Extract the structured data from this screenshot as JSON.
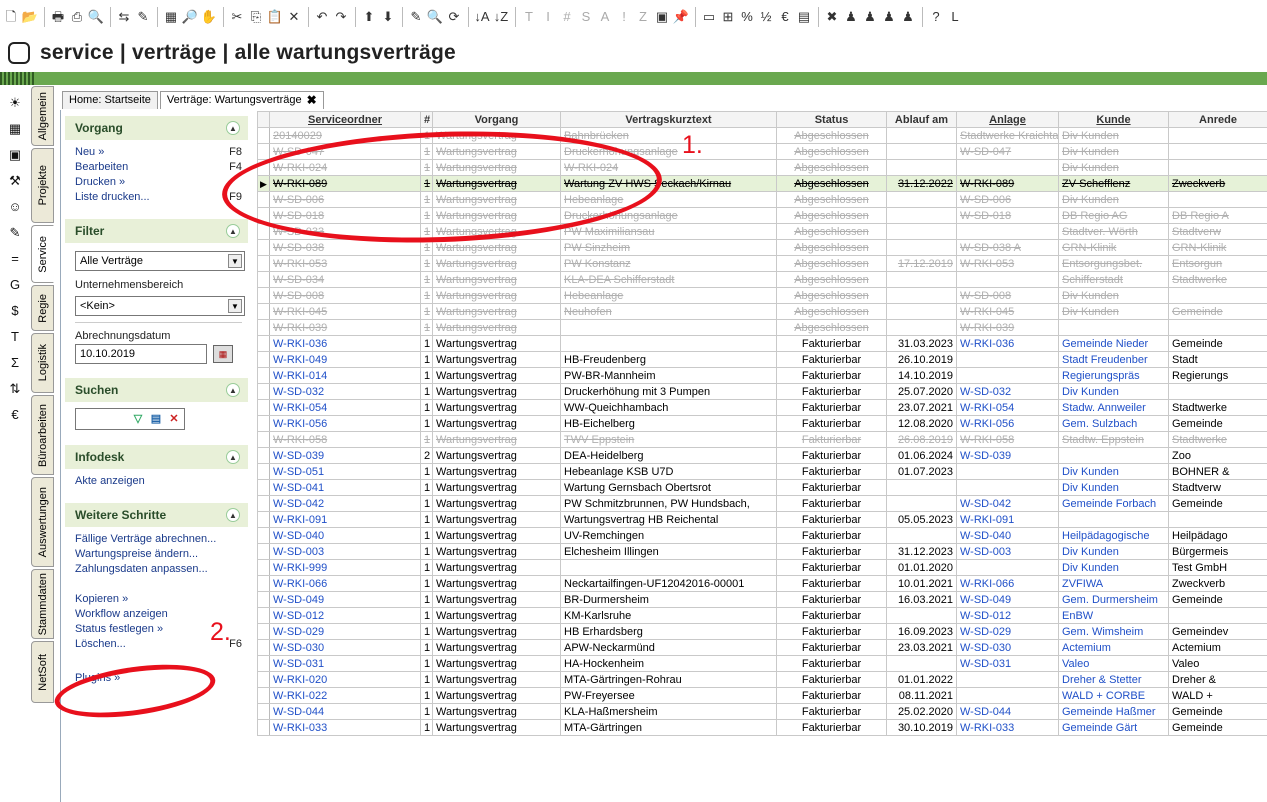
{
  "window": {
    "title": "service | verträge | alle wartungsverträge"
  },
  "toolbar": {
    "icons": [
      "new-document",
      "open-folder",
      "sep",
      "print",
      "print-setup",
      "print-preview",
      "sep",
      "transfer",
      "filter-clear",
      "sep",
      "grid",
      "search-doc",
      "hand",
      "sep",
      "cut",
      "copy",
      "paste",
      "delete",
      "sep",
      "undo",
      "redo",
      "sep",
      "arrow-up",
      "arrow-down",
      "sep",
      "edit",
      "search",
      "refresh",
      "sep",
      "sort-asc",
      "sort-desc",
      "sep",
      "T",
      "I",
      "#",
      "S",
      "A",
      "!",
      "Z",
      "image",
      "pin",
      "sep",
      "field",
      "plus-doc",
      "percent",
      "decimal",
      "currency",
      "grid2",
      "sep",
      "excel",
      "figure1",
      "figure2",
      "figure3",
      "figure4",
      "sep",
      "help",
      "L"
    ]
  },
  "left_icons": [
    "sun-icon",
    "grid-icon",
    "box-icon",
    "hammer-icon",
    "smile-icon",
    "pen-icon",
    "equals-icon",
    "g-icon",
    "dollar-icon",
    "t-icon",
    "sigma-icon",
    "arrows-icon",
    "e-icon"
  ],
  "vtabs": [
    "Allgemein",
    "Projekte",
    "Service",
    "Regie",
    "Logistik",
    "Büroarbeiten",
    "Auswertungen",
    "Stammdaten",
    "NetSoft"
  ],
  "tabs": [
    {
      "label": "Home: Startseite",
      "active": false
    },
    {
      "label": "Verträge: Wartungsverträge",
      "active": true,
      "close": "✖"
    }
  ],
  "sidebar": {
    "vorgang": {
      "title": "Vorgang",
      "items": [
        {
          "label": "Neu »",
          "key": "F8"
        },
        {
          "label": "Bearbeiten",
          "key": "F4"
        },
        {
          "label": "Drucken »",
          "key": ""
        },
        {
          "label": "Liste drucken...",
          "key": "F9"
        }
      ]
    },
    "filter": {
      "title": "Filter",
      "select_value": "Alle Verträge",
      "unternehmen_label": "Unternehmensbereich",
      "unternehmen_value": "<Kein>",
      "abrechnung_label": "Abrechnungsdatum",
      "abrechnung_value": "10.10.2019"
    },
    "suchen": {
      "title": "Suchen"
    },
    "infodesk": {
      "title": "Infodesk",
      "items": [
        "Akte anzeigen"
      ]
    },
    "weitere": {
      "title": "Weitere Schritte",
      "items": [
        {
          "label": "Fällige Verträge abrechnen...",
          "key": ""
        },
        {
          "label": "Wartungspreise ändern...",
          "key": ""
        },
        {
          "label": "Zahlungsdaten anpassen...",
          "key": ""
        },
        {
          "label": "",
          "key": ""
        },
        {
          "label": "Kopieren »",
          "key": ""
        },
        {
          "label": "Workflow anzeigen",
          "key": ""
        },
        {
          "label": "Status festlegen »",
          "key": ""
        },
        {
          "label": "Löschen...",
          "key": "F6"
        }
      ]
    },
    "plugins": {
      "label": "Plugins »"
    }
  },
  "grid": {
    "columns": [
      "Serviceordner",
      "#",
      "Vorgang",
      "Vertragskurztext",
      "Status",
      "Ablauf am",
      "Anlage",
      "Kunde",
      "Anrede"
    ],
    "rows": [
      {
        "s": "done",
        "c": [
          "20140029",
          "1",
          "Wartungsvertrag",
          "Bahnbrücken",
          "Abgeschlossen",
          "",
          "Stadtwerke Kraichtal",
          "Div Kunden",
          ""
        ]
      },
      {
        "s": "done",
        "c": [
          "W-SD-047",
          "1",
          "Wartungsvertrag",
          "Druckerhöhungsanlage",
          "Abgeschlossen",
          "",
          "W-SD-047",
          "Div Kunden",
          ""
        ]
      },
      {
        "s": "done",
        "c": [
          "W-RKI-024",
          "1",
          "Wartungsvertrag",
          "W-RKI-024",
          "Abgeschlossen",
          "",
          "",
          "Div Kunden",
          ""
        ]
      },
      {
        "s": "cur",
        "c": [
          "W-RKI-089",
          "1",
          "Wartungsvertrag",
          "Wartung ZV HWS Seckach/Kirnau",
          "Abgeschlossen",
          "31.12.2022",
          "W-RKI-089",
          "ZV Schefflenz",
          "Zweckverb"
        ]
      },
      {
        "s": "done",
        "c": [
          "W-SD-006",
          "1",
          "Wartungsvertrag",
          "Hebeanlage",
          "Abgeschlossen",
          "",
          "W-SD-006",
          "Div Kunden",
          ""
        ]
      },
      {
        "s": "done",
        "c": [
          "W-SD-018",
          "1",
          "Wartungsvertrag",
          "Druckerhöhungsanlage",
          "Abgeschlossen",
          "",
          "W-SD-018",
          "DB Regio AG",
          "DB Regio A"
        ]
      },
      {
        "s": "done",
        "c": [
          "W-SD-033",
          "1",
          "Wartungsvertrag",
          "PW Maximiliansau",
          "Abgeschlossen",
          "",
          "",
          "Stadtver. Wörth",
          "Stadtverw"
        ]
      },
      {
        "s": "done",
        "c": [
          "W-SD-038",
          "1",
          "Wartungsvertrag",
          "PW Sinzheim",
          "Abgeschlossen",
          "",
          "W-SD-038 A",
          "GRN-Klinik",
          "GRN-Klinik"
        ]
      },
      {
        "s": "done",
        "c": [
          "W-RKI-053",
          "1",
          "Wartungsvertrag",
          "PW Konstanz",
          "Abgeschlossen",
          "17.12.2019",
          "W-RKI-053",
          "Entsorgungsbet.",
          "Entsorgun"
        ]
      },
      {
        "s": "done",
        "c": [
          "W-SD-034",
          "1",
          "Wartungsvertrag",
          "KLA-DEA Schifferstadt",
          "Abgeschlossen",
          "",
          "",
          "Schifferstadt",
          "Stadtwerke"
        ]
      },
      {
        "s": "done",
        "c": [
          "W-SD-008",
          "1",
          "Wartungsvertrag",
          "Hebeanlage",
          "Abgeschlossen",
          "",
          "W-SD-008",
          "Div Kunden",
          ""
        ]
      },
      {
        "s": "done",
        "c": [
          "W-RKI-045",
          "1",
          "Wartungsvertrag",
          "Neuhofen",
          "Abgeschlossen",
          "",
          "W-RKI-045",
          "Div Kunden",
          "Gemeinde"
        ]
      },
      {
        "s": "done",
        "c": [
          "W-RKI-039",
          "1",
          "Wartungsvertrag",
          "",
          "Abgeschlossen",
          "",
          "W-RKI-039",
          "",
          ""
        ]
      },
      {
        "s": "",
        "c": [
          "W-RKI-036",
          "1",
          "Wartungsvertrag",
          "",
          "Fakturierbar",
          "31.03.2023",
          "W-RKI-036",
          "Gemeinde Nieder",
          "Gemeinde"
        ]
      },
      {
        "s": "",
        "c": [
          "W-RKI-049",
          "1",
          "Wartungsvertrag",
          "HB-Freudenberg",
          "Fakturierbar",
          "26.10.2019",
          "",
          "Stadt Freudenber",
          "Stadt"
        ]
      },
      {
        "s": "",
        "c": [
          "W-RKI-014",
          "1",
          "Wartungsvertrag",
          "PW-BR-Mannheim",
          "Fakturierbar",
          "14.10.2019",
          "",
          "Regierungspräs",
          "Regierungs"
        ]
      },
      {
        "s": "",
        "c": [
          "W-SD-032",
          "1",
          "Wartungsvertrag",
          "Druckerhöhung mit 3 Pumpen",
          "Fakturierbar",
          "25.07.2020",
          "W-SD-032",
          "Div Kunden",
          ""
        ]
      },
      {
        "s": "",
        "c": [
          "W-RKI-054",
          "1",
          "Wartungsvertrag",
          "WW-Queichhambach",
          "Fakturierbar",
          "23.07.2021",
          "W-RKI-054",
          "Stadw. Annweiler",
          "Stadtwerke"
        ]
      },
      {
        "s": "",
        "c": [
          "W-RKI-056",
          "1",
          "Wartungsvertrag",
          "HB-Eichelberg",
          "Fakturierbar",
          "12.08.2020",
          "W-RKI-056",
          "Gem. Sulzbach",
          "Gemeinde"
        ]
      },
      {
        "s": "done",
        "c": [
          "W-RKI-058",
          "1",
          "Wartungsvertrag",
          "TWV Eppstein",
          "Fakturierbar",
          "26.08.2019",
          "W-RKI-058",
          "Stadtw. Eppstein",
          "Stadtwerke"
        ]
      },
      {
        "s": "",
        "c": [
          "W-SD-039",
          "2",
          "Wartungsvertrag",
          "DEA-Heidelberg",
          "Fakturierbar",
          "01.06.2024",
          "W-SD-039",
          "",
          "Zoo"
        ]
      },
      {
        "s": "",
        "c": [
          "W-SD-051",
          "1",
          "Wartungsvertrag",
          "Hebeanlage KSB U7D",
          "Fakturierbar",
          "01.07.2023",
          "",
          "Div Kunden",
          "BOHNER &"
        ]
      },
      {
        "s": "",
        "c": [
          "W-SD-041",
          "1",
          "Wartungsvertrag",
          "Wartung Gernsbach Obertsrot",
          "Fakturierbar",
          "",
          "",
          "Div Kunden",
          "Stadtverw"
        ]
      },
      {
        "s": "",
        "c": [
          "W-SD-042",
          "1",
          "Wartungsvertrag",
          "PW Schmitzbrunnen, PW Hundsbach,",
          "Fakturierbar",
          "",
          "W-SD-042",
          "Gemeinde Forbach",
          "Gemeinde"
        ]
      },
      {
        "s": "",
        "c": [
          "W-RKI-091",
          "1",
          "Wartungsvertrag",
          "Wartungsvertrag HB Reichental",
          "Fakturierbar",
          "05.05.2023",
          "W-RKI-091",
          "",
          ""
        ]
      },
      {
        "s": "",
        "c": [
          "W-SD-040",
          "1",
          "Wartungsvertrag",
          "UV-Remchingen",
          "Fakturierbar",
          "",
          "W-SD-040",
          "Heilpädagogische",
          "Heilpädago"
        ]
      },
      {
        "s": "",
        "c": [
          "W-SD-003",
          "1",
          "Wartungsvertrag",
          "Elchesheim Illingen",
          "Fakturierbar",
          "31.12.2023",
          "W-SD-003",
          "Div Kunden",
          "Bürgermeis"
        ]
      },
      {
        "s": "",
        "c": [
          "W-RKI-999",
          "1",
          "Wartungsvertrag",
          "",
          "Fakturierbar",
          "01.01.2020",
          "",
          "Div Kunden",
          "Test GmbH"
        ]
      },
      {
        "s": "",
        "c": [
          "W-RKI-066",
          "1",
          "Wartungsvertrag",
          "Neckartailfingen-UF12042016-00001",
          "Fakturierbar",
          "10.01.2021",
          "W-RKI-066",
          "ZVFIWA",
          "Zweckverb"
        ]
      },
      {
        "s": "",
        "c": [
          "W-SD-049",
          "1",
          "Wartungsvertrag",
          "BR-Durmersheim",
          "Fakturierbar",
          "16.03.2021",
          "W-SD-049",
          "Gem. Durmersheim",
          "Gemeinde"
        ]
      },
      {
        "s": "",
        "c": [
          "W-SD-012",
          "1",
          "Wartungsvertrag",
          "KM-Karlsruhe",
          "Fakturierbar",
          "",
          "W-SD-012",
          "EnBW",
          ""
        ]
      },
      {
        "s": "",
        "c": [
          "W-SD-029",
          "1",
          "Wartungsvertrag",
          "HB Erhardsberg",
          "Fakturierbar",
          "16.09.2023",
          "W-SD-029",
          "Gem. Wimsheim",
          "Gemeindev"
        ]
      },
      {
        "s": "",
        "c": [
          "W-SD-030",
          "1",
          "Wartungsvertrag",
          "APW-Neckarmünd",
          "Fakturierbar",
          "23.03.2021",
          "W-SD-030",
          "Actemium",
          "Actemium"
        ]
      },
      {
        "s": "",
        "c": [
          "W-SD-031",
          "1",
          "Wartungsvertrag",
          "HA-Hockenheim",
          "Fakturierbar",
          "",
          "W-SD-031",
          "Valeo",
          "Valeo"
        ]
      },
      {
        "s": "",
        "c": [
          "W-RKI-020",
          "1",
          "Wartungsvertrag",
          "MTA-Gärtringen-Rohrau",
          "Fakturierbar",
          "01.01.2022",
          "",
          "Dreher & Stetter",
          "Dreher &"
        ]
      },
      {
        "s": "",
        "c": [
          "W-RKI-022",
          "1",
          "Wartungsvertrag",
          "PW-Freyersee",
          "Fakturierbar",
          "08.11.2021",
          "",
          "WALD + CORBE",
          "WALD +"
        ]
      },
      {
        "s": "",
        "c": [
          "W-SD-044",
          "1",
          "Wartungsvertrag",
          "KLA-Haßmersheim",
          "Fakturierbar",
          "25.02.2020",
          "W-SD-044",
          "Gemeinde Haßmer",
          "Gemeinde"
        ]
      },
      {
        "s": "",
        "c": [
          "W-RKI-033",
          "1",
          "Wartungsvertrag",
          "MTA-Gärtringen",
          "Fakturierbar",
          "30.10.2019",
          "W-RKI-033",
          "Gemeinde Gärt",
          "Gemeinde"
        ]
      }
    ]
  },
  "annotations": {
    "label1": "1.",
    "label2": "2."
  },
  "colors": {
    "accent_green": "#6aa84f",
    "link_blue": "#2050c8",
    "annotation_red": "#e8101c"
  }
}
